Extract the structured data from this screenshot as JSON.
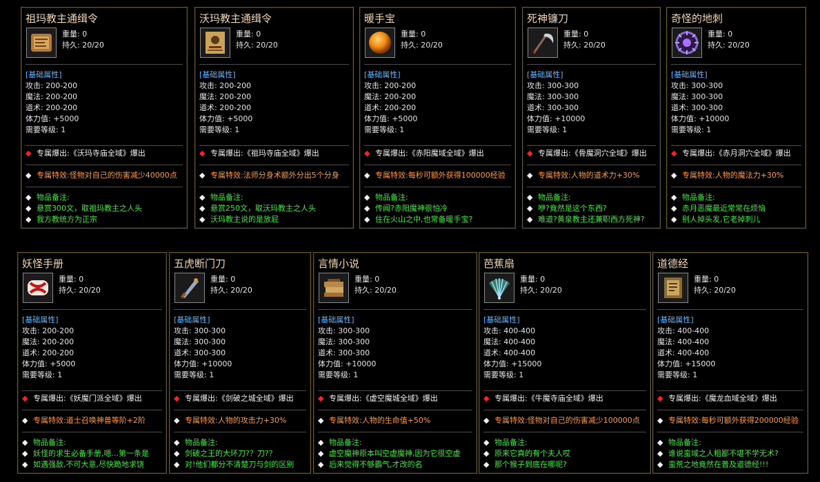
{
  "labels": {
    "weight": "重量: 0",
    "durability": "持久: 20/20",
    "basic_header": "[基础属性]",
    "level": "需要等级: 1",
    "notes_header": "物品备注:",
    "bullet_red": "◆",
    "bullet_white": "◆"
  },
  "items": [
    {
      "name": "祖玛教主通缉令",
      "icon": "scroll-map-icon",
      "atk": "攻击: 200-200",
      "mag": "魔法: 200-200",
      "tao": "道术: 200-200",
      "hp": "体力值: +5000",
      "drop": "专属爆出:《沃玛寺庙全域》爆出",
      "special": "专属特效:怪物对自己的伤害减少40000点",
      "note1": "悬赏300文，取祖玛教主之人头",
      "note2": "我方教统方为正宗"
    },
    {
      "name": "沃玛教主通缉令",
      "icon": "wanted-poster-icon",
      "atk": "攻击: 200-200",
      "mag": "魔法: 200-200",
      "tao": "道术: 200-200",
      "hp": "体力值: +5000",
      "drop": "专属爆出:《祖玛寺庙全域》爆出",
      "special": "专属特效:法师分身术额外分出5个分身",
      "note1": "悬赏250文，取沃玛教主之人头",
      "note2": "沃玛教主说的是放屁"
    },
    {
      "name": "暖手宝",
      "icon": "orange-orb-icon",
      "atk": "攻击: 200-200",
      "mag": "魔法: 200-200",
      "tao": "道术: 200-200",
      "hp": "体力值: +5000",
      "drop": "专属爆出:《赤阳魔域全域》爆出",
      "special": "专属特效:每秒可额外获得100000经验",
      "note1": "传闻?赤阳魔神很怕冷",
      "note2": "住在火山之中,也常备暖手宝?"
    },
    {
      "name": "死神镰刀",
      "icon": "scythe-icon",
      "atk": "攻击: 300-300",
      "mag": "魔法: 300-300",
      "tao": "道术: 300-300",
      "hp": "体力值: +10000",
      "drop": "专属爆出:《骨魔洞穴全域》爆出",
      "special": "专属特效:人物的道术力+30%",
      "note1": "咿?竟然是这个东西?",
      "note2": "难道?黄泉教主还兼职西方死神?"
    },
    {
      "name": "奇怪的地刺",
      "icon": "spike-ring-icon",
      "atk": "攻击: 300-300",
      "mag": "魔法: 300-300",
      "tao": "道术: 300-300",
      "hp": "体力值: +10000",
      "drop": "专属爆出:《赤月洞穴全域》爆出",
      "special": "专属特效:人物的魔法力+30%",
      "note1": "赤月恶魔最近常常在烦恼",
      "note2": "别人掉头发,它老掉刺儿"
    },
    {
      "name": "妖怪手册",
      "icon": "book-scroll-icon",
      "atk": "攻击: 200-200",
      "mag": "魔法: 200-200",
      "tao": "道术: 200-200",
      "hp": "体力值: +5000",
      "drop": "专属爆出:《妖魔门派全域》爆出",
      "special": "专属特效:道士召唤神兽等阶+2阶",
      "note1": "妖怪的求生必备手册,嗯...第一条是",
      "note2": "如遇强敌,不可大意,尽快跪地求饶"
    },
    {
      "name": "五虎断门刀",
      "icon": "broadsword-icon",
      "atk": "攻击: 300-300",
      "mag": "魔法: 300-300",
      "tao": "道术: 300-300",
      "hp": "体力值: +10000",
      "drop": "专属爆出:《剑破之城全域》爆出",
      "special": "专属特效:人物的攻击力+30%",
      "note1": "剑破之王的大环刀?？刀?？",
      "note2": "对!他们都分不清楚刀与剑的区别"
    },
    {
      "name": "言情小说",
      "icon": "book-stack-icon",
      "atk": "攻击: 300-300",
      "mag": "魔法: 300-300",
      "tao": "道术: 300-300",
      "hp": "体力值: +10000",
      "drop": "专属爆出:《虚空魔城全域》爆出",
      "special": "专属特效:人物的生命值+50%",
      "note1": "虚空魔神原本叫空虚魔神,因为它很空虚",
      "note2": "后来觉得不够霸气,才改的名"
    },
    {
      "name": "芭蕉扇",
      "icon": "fan-icon",
      "atk": "攻击: 400-400",
      "mag": "魔法: 400-400",
      "tao": "道术: 400-400",
      "hp": "体力值: +15000",
      "drop": "专属爆出:《牛魔寺庙全域》爆出",
      "special": "专属特效:怪物对自己的伤害减少100000点",
      "note1": "原来它真的有个夫人哎",
      "note2": "那个猴子到底在哪呢?"
    },
    {
      "name": "道德经",
      "icon": "tome-icon",
      "atk": "攻击: 400-400",
      "mag": "魔法: 400-400",
      "tao": "道术: 400-400",
      "hp": "体力值: +15000",
      "drop": "专属爆出:《魔龙血域全域》爆出",
      "special": "专属特效:每秒可额外获得200000经验",
      "note1": "谁说蛮域之人粗鄙不堪不学无术?",
      "note2": "蛮荒之地竟然在普及道德经!!!"
    }
  ]
}
